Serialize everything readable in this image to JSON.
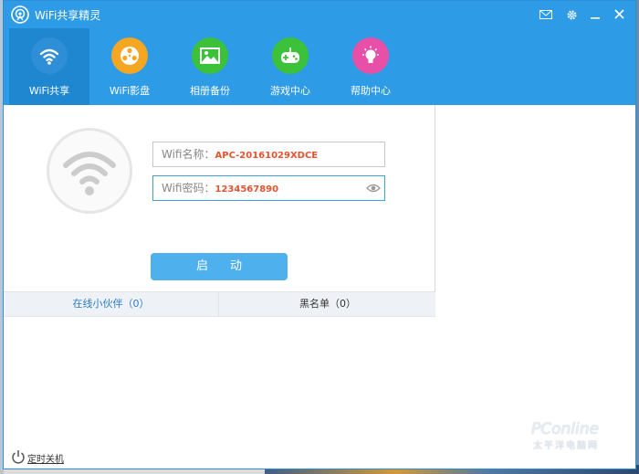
{
  "app": {
    "title": "WiFi共享精灵",
    "logo_icon": "wifi-logo-icon",
    "titlebar_buttons": [
      {
        "name": "mail-icon",
        "glyph": "✉"
      },
      {
        "name": "gear-icon",
        "glyph": "⚙"
      },
      {
        "name": "minimize-icon",
        "glyph": "—"
      },
      {
        "name": "close-icon",
        "glyph": "✕"
      }
    ]
  },
  "nav": {
    "items": [
      {
        "label": "WiFi共享",
        "icon": "wifi-icon",
        "color": "#2f8fd6",
        "active": true
      },
      {
        "label": "WiFi影盘",
        "icon": "film-reel-icon",
        "color": "#f5a623",
        "active": false
      },
      {
        "label": "相册备份",
        "icon": "photo-icon",
        "color": "#3cc13b",
        "active": false
      },
      {
        "label": "游戏中心",
        "icon": "gamepad-icon",
        "color": "#3cc13b",
        "active": false
      },
      {
        "label": "帮助中心",
        "icon": "lightbulb-icon",
        "color": "#e84fa6",
        "active": false
      }
    ]
  },
  "form": {
    "ssid_label": "Wifi名称：",
    "ssid_value": "APC-20161029XDCE",
    "password_label": "Wifi密码：",
    "password_value": "1234567890",
    "start_button": "启动"
  },
  "tabs": {
    "online": "在线小伙伴（0）",
    "blacklist": "黑名单（0）"
  },
  "footer": {
    "shutdown_label": "定时关机"
  },
  "watermark": {
    "brand": "PConline",
    "sub": "太平洋电脑网"
  },
  "colors": {
    "accent": "#2e9be6",
    "value_text": "#e4532f",
    "button": "#4eb1ee"
  }
}
